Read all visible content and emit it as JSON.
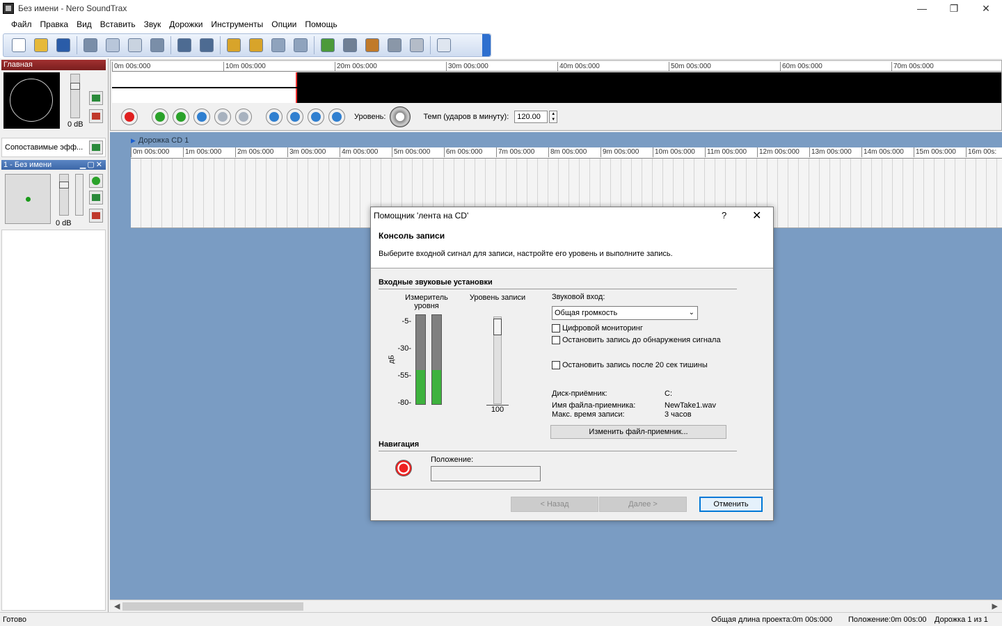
{
  "window": {
    "title": "Без имени - Nero SoundTrax",
    "controls": {
      "minimize": "—",
      "maximize": "❐",
      "close": "✕"
    }
  },
  "menu": [
    "Файл",
    "Правка",
    "Вид",
    "Вставить",
    "Звук",
    "Дорожки",
    "Инструменты",
    "Опции",
    "Помощь"
  ],
  "toolbar": {
    "buttons": [
      {
        "icon": "new-file-icon",
        "color": "#ffffff"
      },
      {
        "icon": "open-folder-icon",
        "color": "#e6b93a"
      },
      {
        "icon": "save-icon",
        "color": "#2a5ca8"
      },
      {
        "icon": "cut-icon",
        "color": "#7a8ea8"
      },
      {
        "icon": "copy-icon",
        "color": "#b8c6da"
      },
      {
        "icon": "paste-icon",
        "color": "#c9d3e0"
      },
      {
        "icon": "delete-icon",
        "color": "#7a8ea8"
      },
      {
        "icon": "undo-icon",
        "color": "#4d6b92"
      },
      {
        "icon": "redo-icon",
        "color": "#4d6b92"
      },
      {
        "icon": "zoom-in-icon",
        "color": "#d8a42a"
      },
      {
        "icon": "zoom-out-icon",
        "color": "#d8a42a"
      },
      {
        "icon": "zoom-selection-icon",
        "color": "#8fa3bd"
      },
      {
        "icon": "zoom-fit-icon",
        "color": "#8fa3bd"
      },
      {
        "icon": "wizard-icon",
        "color": "#4c9a3a"
      },
      {
        "icon": "library-icon",
        "color": "#6f7f94"
      },
      {
        "icon": "audio-properties-icon",
        "color": "#c07a2a"
      },
      {
        "icon": "tools-icon",
        "color": "#8a97a8"
      },
      {
        "icon": "burn-disc-icon",
        "color": "#b4bcc8"
      },
      {
        "icon": "layout-icon",
        "color": "#dfe6f0"
      }
    ]
  },
  "left_panel": {
    "main_title": "Главная",
    "master_db": "0 dB",
    "fx_label": "Сопоставимые эфф...",
    "track_title": "1 - Без имени",
    "track_controls": "▁▢✕",
    "track_db": "0 dB"
  },
  "overview_ruler": [
    "0m 00s:000",
    "10m 00s:000",
    "20m 00s:000",
    "30m 00s:000",
    "40m 00s:000",
    "50m 00s:000",
    "60m 00s:000",
    "70m 00s:000"
  ],
  "transport": {
    "level_label": "Уровень:",
    "tempo_label": "Темп (ударов в минуту):",
    "tempo_value": "120.00",
    "colors": {
      "record": "#e02020",
      "play": "#2aa22a",
      "play_selection": "#2aa22a",
      "loop": "#2f7fd0",
      "pause": "#a8b2bf",
      "stop": "#a8b2bf",
      "to_start": "#2f7fd0",
      "rewind": "#2f7fd0",
      "forward": "#2f7fd0",
      "to_end": "#2f7fd0"
    }
  },
  "track_area": {
    "track_name": "Дорожка CD 1",
    "ruler": [
      "0m 00s:000",
      "1m 00s:000",
      "2m 00s:000",
      "3m 00s:000",
      "4m 00s:000",
      "5m 00s:000",
      "6m 00s:000",
      "7m 00s:000",
      "8m 00s:000",
      "9m 00s:000",
      "10m 00s:000",
      "11m 00s:000",
      "12m 00s:000",
      "13m 00s:000",
      "14m 00s:000",
      "15m 00s:000",
      "16m 00s:"
    ]
  },
  "status": {
    "ready": "Готово",
    "project_length": "Общая длина проекта:0m 00s:000",
    "position": "Положение:0m 00s:00",
    "track": "Дорожка 1 из 1"
  },
  "dialog": {
    "title": "Помощник 'лента на CD'",
    "help": "?",
    "close": "✕",
    "header_title": "Консоль записи",
    "header_desc": "Выберите входной сигнал для записи, настройте его уровень и выполните запись.",
    "input_group": "Входные звуковые установки",
    "meter_label": "Измеритель уровня",
    "rec_level_label": "Уровень записи",
    "db_axis": "дБ",
    "scale": [
      "-5-",
      "-30-",
      "-55-",
      "-80-"
    ],
    "meter_levels": [
      0.38,
      0.38
    ],
    "rec_level_value": "100",
    "sound_input_label": "Звуковой вход:",
    "sound_input_value": "Общая громкость",
    "check_digital": "Цифровой мониторинг",
    "check_stop_until_signal": "Остановить запись до обнаружения сигнала",
    "check_stop_after_silence": "Остановить запись после 20 сек тишины",
    "disk_label": "Диск-приёмник:",
    "disk_value": "C:",
    "file_label": "Имя файла-приемника:",
    "file_value": "NewTake1.wav",
    "max_time_label": "Макс. время записи:",
    "max_time_value": "3 часов",
    "change_file_button": "Изменить файл-приемник...",
    "nav_group": "Навигация",
    "position_label": "Положение:",
    "back_button": "< Назад",
    "next_button": "Далее >",
    "cancel_button": "Отменить"
  }
}
